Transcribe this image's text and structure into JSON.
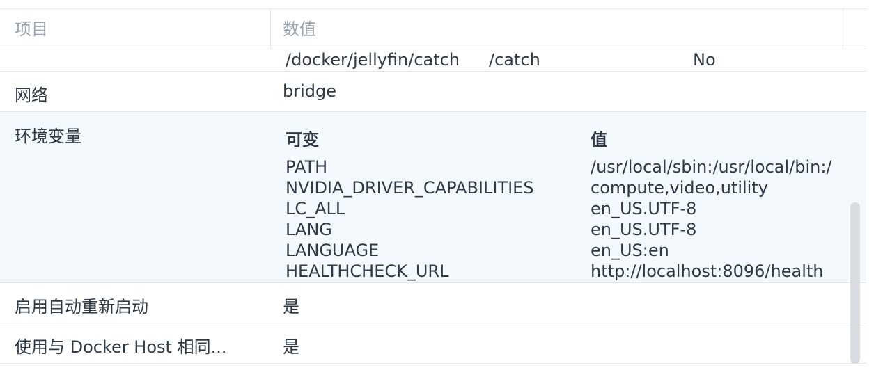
{
  "table": {
    "header": {
      "key": "项目",
      "value": "数值"
    },
    "volume_row": {
      "host_path": "/docker/jellyfin/catch",
      "container_path": "/catch",
      "read_only": "No"
    },
    "network": {
      "key": "网络",
      "value": "bridge"
    },
    "environment": {
      "key": "环境变量",
      "var_header": "可变",
      "value_header": "值",
      "vars": [
        {
          "name": "PATH",
          "value": "/usr/local/sbin:/usr/local/bin:/"
        },
        {
          "name": "NVIDIA_DRIVER_CAPABILITIES",
          "value": "compute,video,utility"
        },
        {
          "name": "LC_ALL",
          "value": "en_US.UTF-8"
        },
        {
          "name": "LANG",
          "value": "en_US.UTF-8"
        },
        {
          "name": "LANGUAGE",
          "value": "en_US:en"
        },
        {
          "name": "HEALTHCHECK_URL",
          "value": "http://localhost:8096/health"
        }
      ]
    },
    "auto_restart": {
      "key": "启用自动重新启动",
      "value": "是"
    },
    "same_host": {
      "key": "使用与 Docker Host 相同...",
      "value": "是"
    }
  }
}
